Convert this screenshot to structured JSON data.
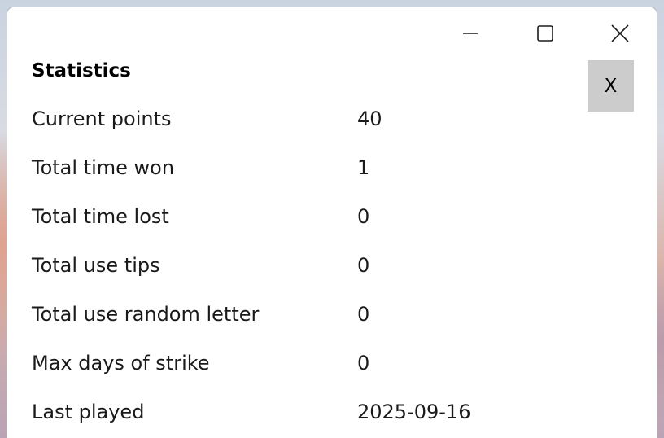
{
  "window": {
    "minimize_icon": "minimize-icon",
    "maximize_icon": "maximize-icon",
    "close_icon": "close-icon"
  },
  "dialog": {
    "title": "Statistics",
    "close_label": "X"
  },
  "stats": [
    {
      "label": "Current points",
      "value": "40"
    },
    {
      "label": "Total time won",
      "value": "1"
    },
    {
      "label": "Total time lost",
      "value": "0"
    },
    {
      "label": "Total use tips",
      "value": "0"
    },
    {
      "label": "Total use random letter",
      "value": "0"
    },
    {
      "label": "Max days of strike",
      "value": "0"
    },
    {
      "label": "Last played",
      "value": "2025-09-16"
    }
  ],
  "colors": {
    "close_button_bg": "#cccccc",
    "window_bg": "#ffffff",
    "text": "#1a1a1a"
  }
}
